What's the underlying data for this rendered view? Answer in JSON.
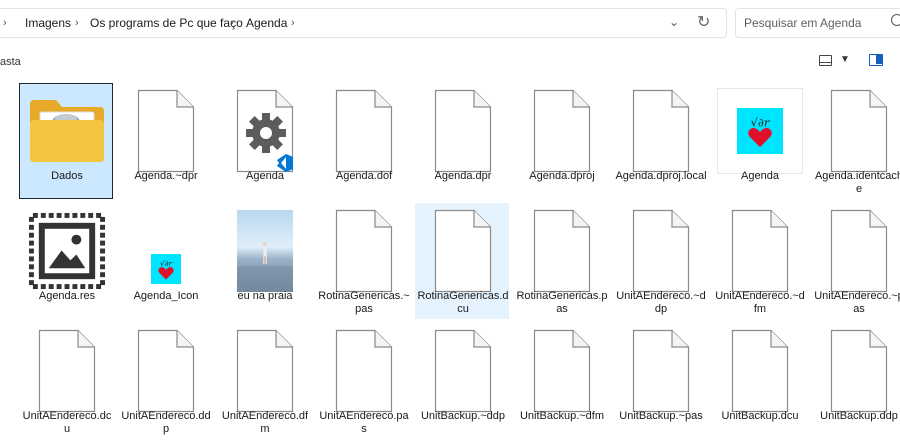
{
  "address_bar": {
    "segments": [
      "Imagens",
      "Os programs de Pc que faço",
      "Agenda"
    ]
  },
  "search": {
    "placeholder": "Pesquisar em Agenda"
  },
  "command_bar": {
    "crumb": "asta"
  },
  "items": [
    {
      "name": "Dados",
      "kind": "folder"
    },
    {
      "name": "Agenda.~dpr",
      "kind": "blank"
    },
    {
      "name": "Agenda",
      "kind": "vscode"
    },
    {
      "name": "Agenda.dof",
      "kind": "blank"
    },
    {
      "name": "Agenda.dpr",
      "kind": "blank"
    },
    {
      "name": "Agenda.dproj",
      "kind": "blank"
    },
    {
      "name": "Agenda.dproj.local",
      "kind": "blank"
    },
    {
      "name": "Agenda",
      "kind": "app-heart"
    },
    {
      "name": "Agenda.identcache",
      "kind": "blank"
    },
    {
      "name": "Agenda.res",
      "kind": "image-icon"
    },
    {
      "name": "Agenda_Icon",
      "kind": "heart-small"
    },
    {
      "name": "eu na praia",
      "kind": "photo"
    },
    {
      "name": "RotinaGenericas.~pas",
      "kind": "blank"
    },
    {
      "name": "RotinaGenericas.dcu",
      "kind": "blank"
    },
    {
      "name": "RotinaGenericas.pas",
      "kind": "blank"
    },
    {
      "name": "UnitAEndereco.~ddp",
      "kind": "blank"
    },
    {
      "name": "UnitAEndereco.~dfm",
      "kind": "blank"
    },
    {
      "name": "UnitAEndereco.~pas",
      "kind": "blank"
    },
    {
      "name": "UnitAEndereco.dcu",
      "kind": "blank"
    },
    {
      "name": "UnitAEndereco.ddp",
      "kind": "blank"
    },
    {
      "name": "UnitAEndereco.dfm",
      "kind": "blank"
    },
    {
      "name": "UnitAEndereco.pas",
      "kind": "blank"
    },
    {
      "name": "UnitBackup.~ddp",
      "kind": "blank"
    },
    {
      "name": "UnitBackup.~dfm",
      "kind": "blank"
    },
    {
      "name": "UnitBackup.~pas",
      "kind": "blank"
    },
    {
      "name": "UnitBackup.dcu",
      "kind": "blank"
    },
    {
      "name": "UnitBackup.ddp",
      "kind": "blank"
    }
  ],
  "icons": {
    "folder_color": "#f5c542",
    "selection_color": "#cce8ff",
    "vscode_blue": "#0078d4",
    "heart_bg": "#00e5ff",
    "heart_color": "#e0102a"
  }
}
